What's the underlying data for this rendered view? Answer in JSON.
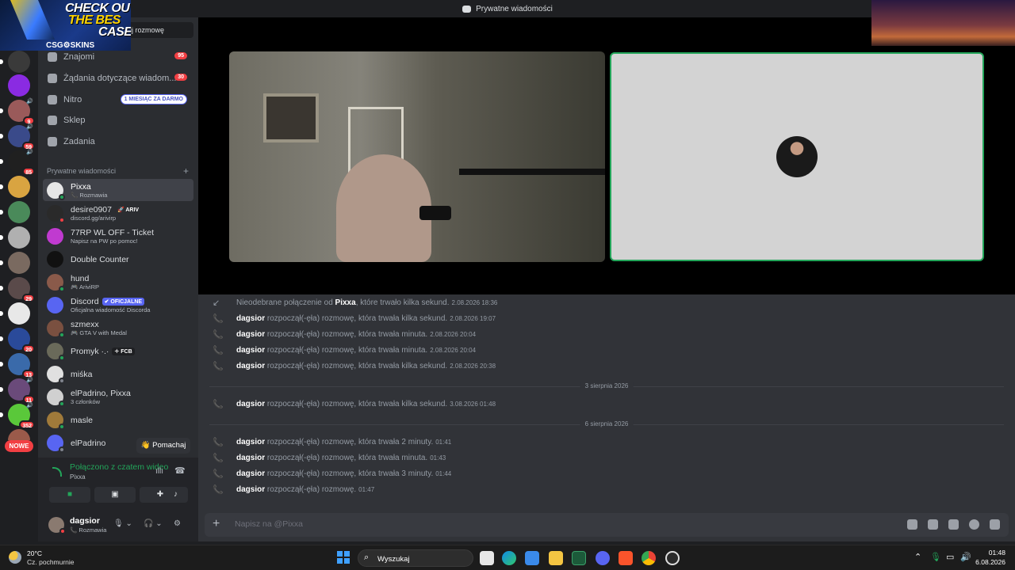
{
  "titlebar": {
    "title": "Prywatne wiadomości"
  },
  "ad": {
    "line1": "CHECK OU",
    "line2": "THE BES",
    "line3": "CASE",
    "brand": "CSG⚙SKINS"
  },
  "guild_badges": [
    "9",
    "59",
    "85",
    "29",
    "20",
    "13",
    "11",
    "352"
  ],
  "guild_new": "NOWE",
  "sidebar": {
    "find_button": "ij rozmowę",
    "nav": [
      {
        "label": "Znajomi",
        "badge": "95"
      },
      {
        "label": "Żądania dotyczące wiadom...",
        "badge": "30"
      },
      {
        "label": "Nitro",
        "pill": "1 MIESIĄC ZA DARMO"
      },
      {
        "label": "Sklep"
      },
      {
        "label": "Zadania"
      }
    ],
    "dm_header": "Prywatne wiadomości",
    "dm_header_plus": "+",
    "dms": [
      {
        "name": "Pixxa",
        "sub": "📞 Rozmawia"
      },
      {
        "name": "desire0907",
        "tag": "🚀 ARIV",
        "sub": "discord.gg/arivirp"
      },
      {
        "name": "77RP WL OFF - Ticket",
        "sub": "Napisz na PW po pomoc!"
      },
      {
        "name": "Double Counter"
      },
      {
        "name": "hund",
        "sub": "🎮 AriviRP"
      },
      {
        "name": "Discord",
        "tag": "✔ OFICJALNE",
        "sub": "Oficjalna wiadomość Discorda"
      },
      {
        "name": "szmexx",
        "sub": "🎮 GTA V with Medal"
      },
      {
        "name": "Promyk ·.·",
        "tag": "✧ FCB"
      },
      {
        "name": "miśka"
      },
      {
        "name": "elPadrino, Pixxa",
        "sub": "3 członków"
      },
      {
        "name": "masle"
      },
      {
        "name": "elPadrino"
      }
    ],
    "wave_button": "👋 Pomachaj"
  },
  "voice": {
    "title": "Połączono z czatem wideo",
    "sub": "Pixxa",
    "wave_glyph": "ıllı",
    "hangup_glyph": "☎",
    "btn_camera": "■",
    "btn_screen": "▣",
    "btn_activity": "✚",
    "btn_soundboard": "♪"
  },
  "user": {
    "name": "dagsior",
    "status": "📞 Rozmawia",
    "mic": "🎙 ⌄",
    "headset": "🎧 ⌄",
    "settings": "⚙"
  },
  "chat": {
    "messages": [
      {
        "missed": true,
        "prefix": "Nieodebrane połączenie od ",
        "who": "Pixxa",
        "text": ", które trwało kilka sekund.",
        "ts": "2.08.2026 18:36"
      },
      {
        "who": "dagsior",
        "text": " rozpoczął(-ęła) rozmowę, która trwała kilka sekund.",
        "ts": "2.08.2026 19:07"
      },
      {
        "who": "dagsior",
        "text": " rozpoczął(-ęła) rozmowę, która trwała minuta.",
        "ts": "2.08.2026 20:04"
      },
      {
        "who": "dagsior",
        "text": " rozpoczął(-ęła) rozmowę, która trwała minuta.",
        "ts": "2.08.2026 20:04"
      },
      {
        "who": "dagsior",
        "text": " rozpoczął(-ęła) rozmowę, która trwała kilka sekund.",
        "ts": "2.08.2026 20:38"
      },
      {
        "who": "dagsior",
        "text": " rozpoczął(-ęła) rozmowę, która trwała kilka sekund.",
        "ts": "3.08.2026 01:48"
      },
      {
        "who": "dagsior",
        "text": " rozpoczął(-ęła) rozmowę, która trwała 2 minuty.",
        "ts": "01:41"
      },
      {
        "who": "dagsior",
        "text": " rozpoczął(-ęła) rozmowę, która trwała minuta.",
        "ts": "01:43"
      },
      {
        "who": "dagsior",
        "text": " rozpoczął(-ęła) rozmowę, która trwała 3 minuty.",
        "ts": "01:44"
      },
      {
        "who": "dagsior",
        "text": " rozpoczął(-ęła) rozmowę.",
        "ts": "01:47"
      }
    ],
    "divider1": "3 sierpnia 2026",
    "divider2": "6 sierpnia 2026",
    "composer_placeholder": "Napisz na @Pixxa"
  },
  "taskbar": {
    "temp": "20°C",
    "condition": "Cz. pochmurnie",
    "search_label": "Wyszukaj",
    "time": "01:48",
    "date": "6.08.2026"
  },
  "colors": {
    "accent_green": "#23a55a",
    "badge_red": "#f23f43",
    "blurple": "#5865f2"
  }
}
